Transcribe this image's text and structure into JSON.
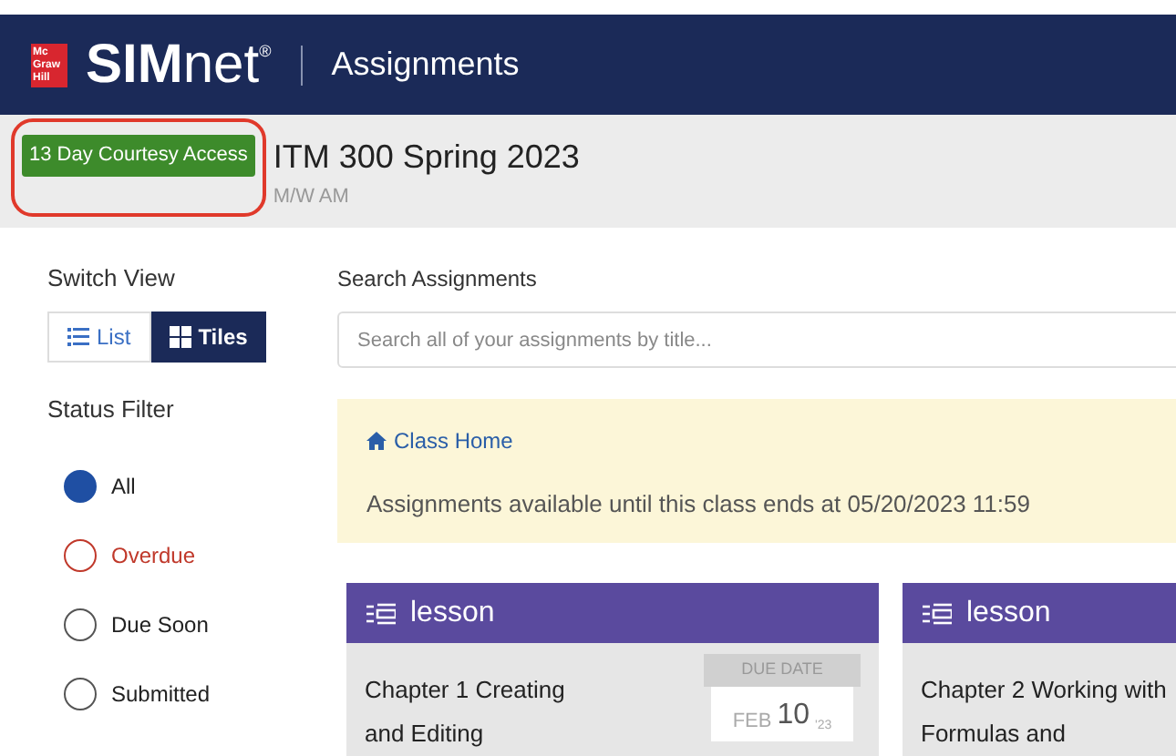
{
  "header": {
    "logo_badge": "Mc Graw Hill",
    "brand_bold": "SIM",
    "brand_light": "net",
    "brand_mark": "®",
    "section": "Assignments"
  },
  "course": {
    "badge": "13 Day Courtesy Access",
    "badge_highlighted": true,
    "title": "ITM 300 Spring 2023",
    "subtitle": "M/W AM"
  },
  "sidebar": {
    "switch_view_label": "Switch View",
    "views": [
      {
        "label": "List",
        "kind": "list",
        "selected": false
      },
      {
        "label": "Tiles",
        "kind": "tiles",
        "selected": true
      }
    ],
    "status_filter_label": "Status Filter",
    "filters": [
      {
        "label": "All",
        "selected": true,
        "color": "#1f4fa3"
      },
      {
        "label": "Overdue",
        "selected": false,
        "color": "#c0392b"
      },
      {
        "label": "Due Soon",
        "selected": false,
        "color": "#555555"
      },
      {
        "label": "Submitted",
        "selected": false,
        "color": "#555555"
      }
    ]
  },
  "search": {
    "label": "Search Assignments",
    "placeholder": "Search all of your assignments by title..."
  },
  "notice": {
    "link": "Class Home",
    "text": "Assignments available until this class ends at 05/20/2023 11:59"
  },
  "cards": [
    {
      "type": "lesson",
      "title": "Chapter 1 Creating and Editing",
      "due_label": "DUE DATE",
      "due_month": "FEB",
      "due_day": "10",
      "due_year": "'23"
    },
    {
      "type": "lesson",
      "title": "Chapter 2 Working with Formulas and"
    }
  ]
}
